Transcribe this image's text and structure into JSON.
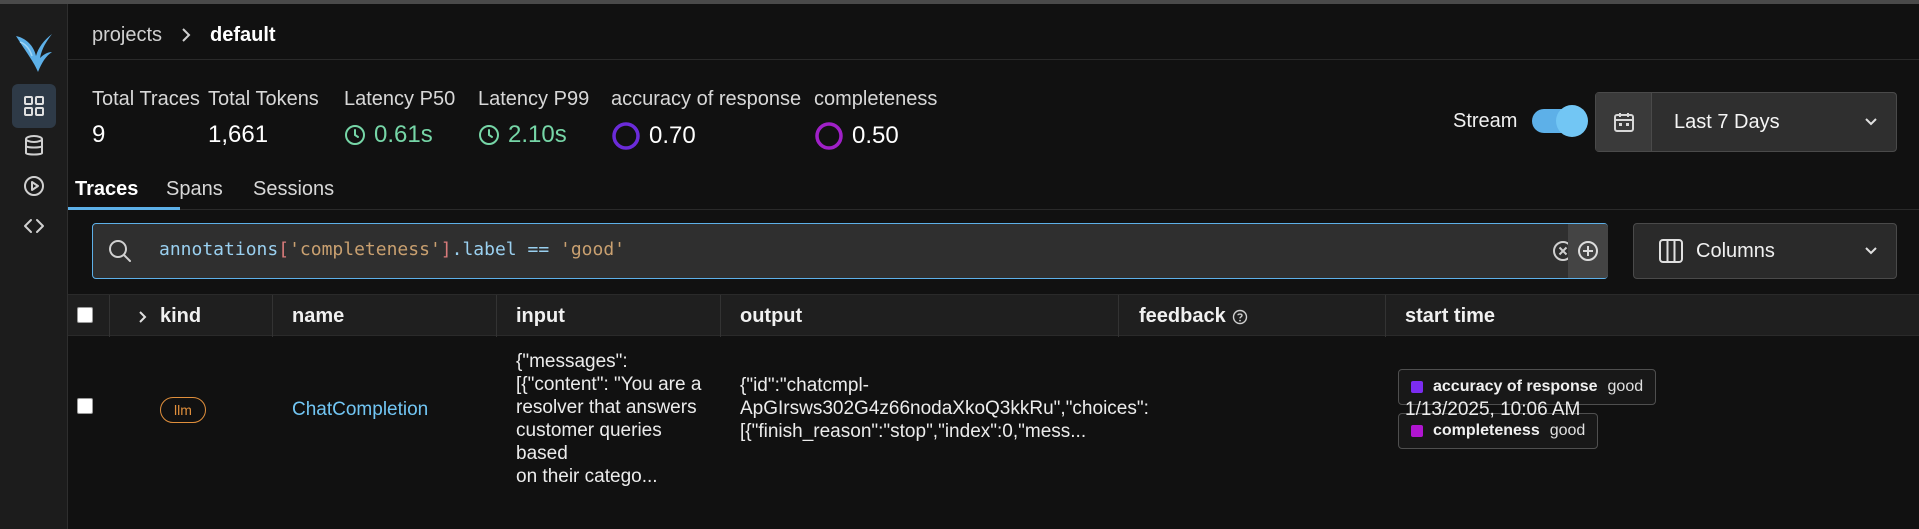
{
  "breadcrumb": {
    "projects": "projects",
    "current": "default"
  },
  "stats": {
    "total_traces": {
      "label": "Total Traces",
      "value": "9"
    },
    "total_tokens": {
      "label": "Total Tokens",
      "value": "1,661"
    },
    "latency_p50": {
      "label": "Latency P50",
      "value": "0.61s",
      "icon": "clock-icon"
    },
    "latency_p99": {
      "label": "Latency P99",
      "value": "2.10s",
      "icon": "clock-icon"
    },
    "accuracy": {
      "label": "accuracy of response",
      "value": "0.70",
      "color": "#6b2bd9"
    },
    "completeness": {
      "label": "completeness",
      "value": "0.50",
      "color": "#a020c8"
    }
  },
  "stream": {
    "label": "Stream",
    "enabled": true
  },
  "time_range": {
    "label": "Last 7 Days"
  },
  "tabs": [
    "Traces",
    "Spans",
    "Sessions"
  ],
  "filter": {
    "prefix": "annotations",
    "key": "'completeness'",
    "middle": ".label == ",
    "value": "'good'"
  },
  "columns_button": {
    "label": "Columns"
  },
  "table": {
    "headers": {
      "kind": "kind",
      "name": "name",
      "input": "input",
      "output": "output",
      "feedback": "feedback",
      "start_time": "start time"
    },
    "rows": [
      {
        "kind": "llm",
        "name": "ChatCompletion",
        "input": [
          "{\"messages\":",
          "[{\"content\": \"You are a",
          "resolver that answers",
          "customer queries based",
          "on their catego..."
        ],
        "output": [
          "{\"id\":\"chatcmpl-",
          "ApGIrsws302G4z66nodaXkoQ3kkRu\",\"choices\":",
          "[{\"finish_reason\":\"stop\",\"index\":0,\"mess..."
        ],
        "feedback": [
          {
            "name": "accuracy of response",
            "label": "good",
            "color": "#7b2cf0"
          },
          {
            "name": "completeness",
            "label": "good",
            "color": "#b015d0"
          }
        ],
        "start_time": "1/13/2025, 10:06 AM"
      }
    ]
  },
  "colors": {
    "accent": "#5db0e8",
    "latency": "#76d6a7",
    "kind_llm": "#e08f3c",
    "link": "#72c6f4"
  }
}
